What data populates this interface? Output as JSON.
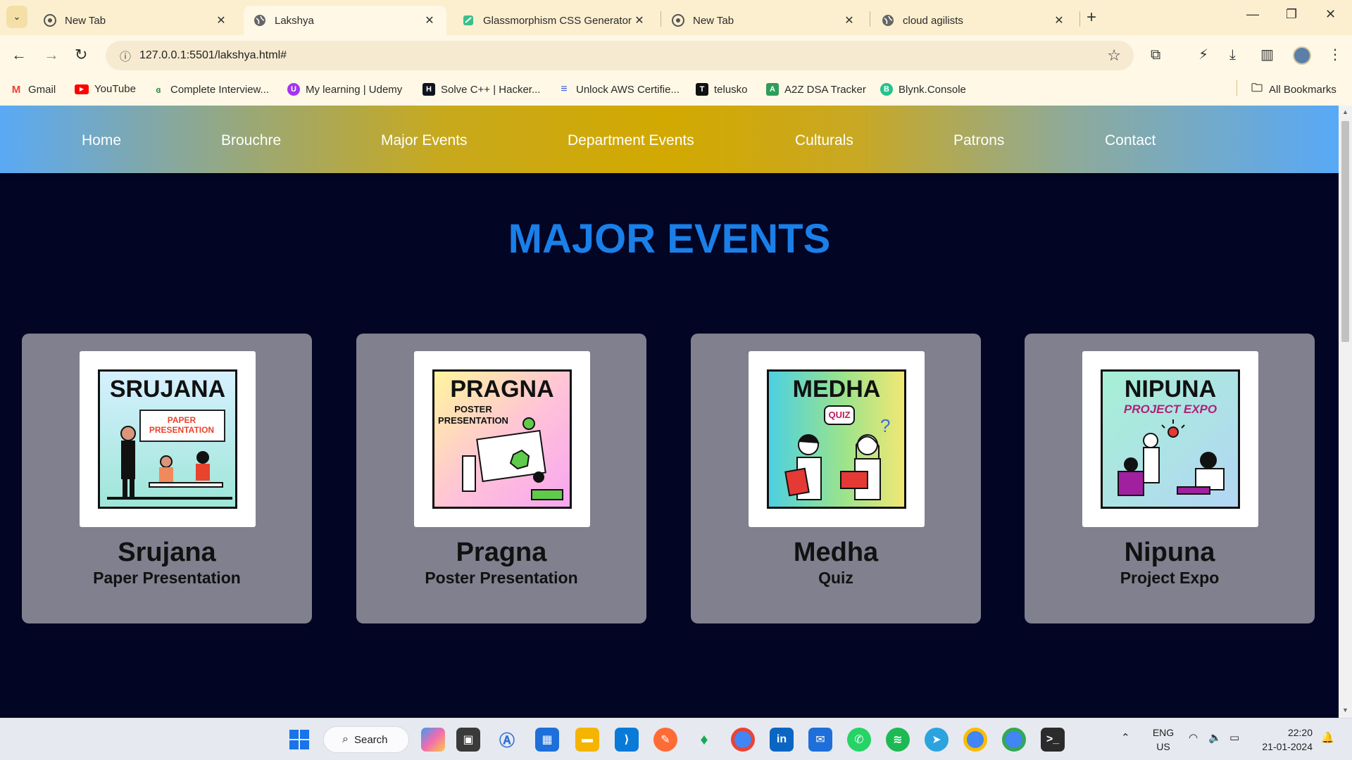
{
  "browser": {
    "tabs": [
      {
        "title": "New Tab",
        "favicon": "chrome-icon",
        "active": false
      },
      {
        "title": "Lakshya",
        "favicon": "globe-icon",
        "active": true
      },
      {
        "title": "Glassmorphism CSS Generator",
        "favicon": "glass-icon",
        "active": false
      },
      {
        "title": "New Tab",
        "favicon": "chrome-icon",
        "active": false
      },
      {
        "title": "cloud agilists",
        "favicon": "globe-icon",
        "active": false
      }
    ],
    "url": "127.0.0.1:5501/lakshya.html#",
    "bookmarks": [
      {
        "label": "Gmail",
        "color": "#ea4335",
        "glyph": "M"
      },
      {
        "label": "YouTube",
        "color": "#ff0000",
        "glyph": "▶"
      },
      {
        "label": "Complete Interview...",
        "color": "#2f8d46",
        "glyph": "G"
      },
      {
        "label": "My learning | Udemy",
        "color": "#a435f0",
        "glyph": "U"
      },
      {
        "label": "Solve C++ | Hacker...",
        "color": "#1ba94c",
        "glyph": "H"
      },
      {
        "label": "Unlock AWS Certifie...",
        "color": "#3b5bdb",
        "glyph": "≡"
      },
      {
        "label": "telusko",
        "color": "#111111",
        "glyph": "T"
      },
      {
        "label": "A2Z DSA Tracker",
        "color": "#2e9d5a",
        "glyph": "A"
      },
      {
        "label": "Blynk.Console",
        "color": "#23c48e",
        "glyph": "B"
      }
    ],
    "all_bookmarks": "All Bookmarks"
  },
  "site": {
    "nav": [
      "Home",
      "Brouchre",
      "Major Events",
      "Department Events",
      "Culturals",
      "Patrons",
      "Contact"
    ],
    "heading": "MAJOR EVENTS",
    "cards": [
      {
        "poster_title": "SRUJANA",
        "poster_sub": "PAPER PRESENTATION",
        "name": "Srujana",
        "sub": "Paper Presentation"
      },
      {
        "poster_title": "PRAGNA",
        "poster_sub": "POSTER PRESENTATION",
        "name": "Pragna",
        "sub": "Poster Presentation"
      },
      {
        "poster_title": "MEDHA",
        "poster_sub": "QUIZ",
        "name": "Medha",
        "sub": "Quiz"
      },
      {
        "poster_title": "NIPUNA",
        "poster_sub": "PROJECT EXPO",
        "name": "Nipuna",
        "sub": "Project Expo"
      }
    ],
    "colors": {
      "heading": "#1a7fe8",
      "page_bg": "#020524",
      "card_bg": "#80808f"
    }
  },
  "taskbar": {
    "search_label": "Search",
    "lang": "ENG",
    "region": "US",
    "time": "22:20",
    "date": "21-01-2024"
  }
}
